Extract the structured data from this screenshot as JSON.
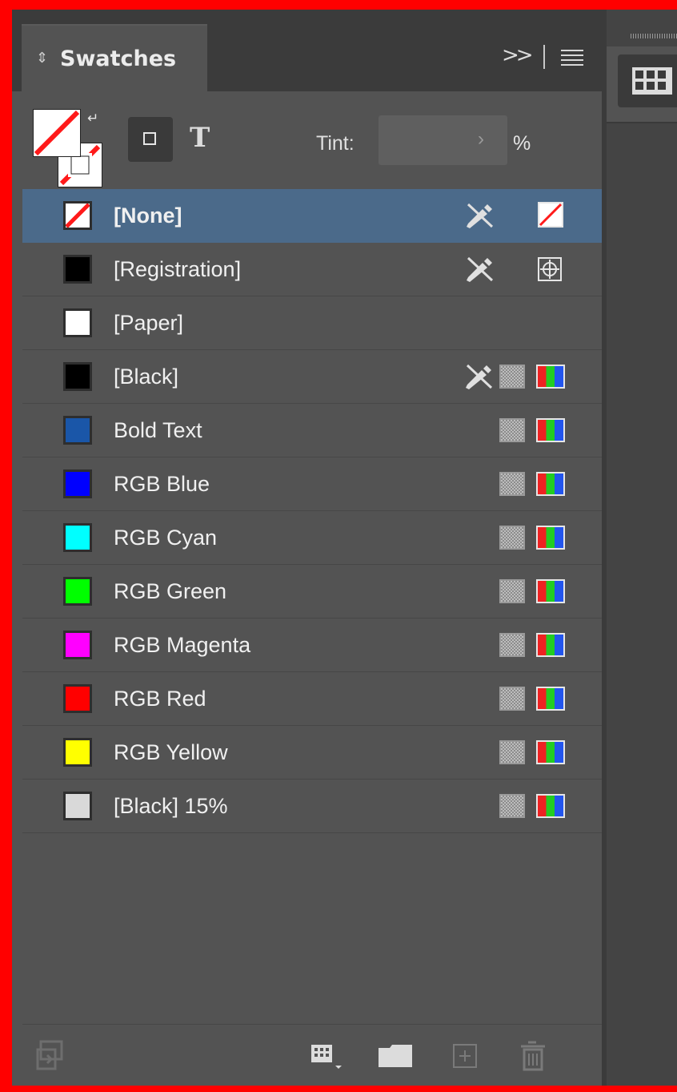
{
  "panel": {
    "title": "Swatches",
    "tint_label": "Tint:",
    "tint_value": "",
    "tint_unit": "%",
    "collapse_symbol": ">>"
  },
  "swatches": [
    {
      "name": "[None]",
      "color": "none",
      "selected": true,
      "locked": true,
      "type_icon": "none"
    },
    {
      "name": "[Registration]",
      "color": "#000000",
      "selected": false,
      "locked": true,
      "type_icon": "registration"
    },
    {
      "name": "[Paper]",
      "color": "#ffffff",
      "selected": false,
      "locked": false,
      "type_icon": ""
    },
    {
      "name": "[Black]",
      "color": "#000000",
      "selected": false,
      "locked": true,
      "type_icon": "process-rgb"
    },
    {
      "name": "Bold Text",
      "color": "#1a56a8",
      "selected": false,
      "locked": false,
      "type_icon": "process-rgb"
    },
    {
      "name": "RGB Blue",
      "color": "#0000ff",
      "selected": false,
      "locked": false,
      "type_icon": "process-rgb"
    },
    {
      "name": "RGB Cyan",
      "color": "#00ffff",
      "selected": false,
      "locked": false,
      "type_icon": "process-rgb"
    },
    {
      "name": "RGB Green",
      "color": "#00ff00",
      "selected": false,
      "locked": false,
      "type_icon": "process-rgb"
    },
    {
      "name": "RGB Magenta",
      "color": "#ff00ff",
      "selected": false,
      "locked": false,
      "type_icon": "process-rgb"
    },
    {
      "name": "RGB Red",
      "color": "#ff0000",
      "selected": false,
      "locked": false,
      "type_icon": "process-rgb"
    },
    {
      "name": "RGB Yellow",
      "color": "#ffff00",
      "selected": false,
      "locked": false,
      "type_icon": "process-rgb"
    },
    {
      "name": "[Black] 15%",
      "color": "#d9d9d9",
      "selected": false,
      "locked": false,
      "type_icon": "process-rgb"
    }
  ],
  "footer_icons": [
    "import-swatches-icon",
    "swatch-view-icon",
    "new-color-group-icon",
    "new-swatch-icon",
    "delete-swatch-icon"
  ],
  "colors": {
    "panel_bg": "#535353",
    "header_bg": "#3b3b3b",
    "selected_row": "#4b6a8a",
    "frame_border": "#ff0000"
  }
}
